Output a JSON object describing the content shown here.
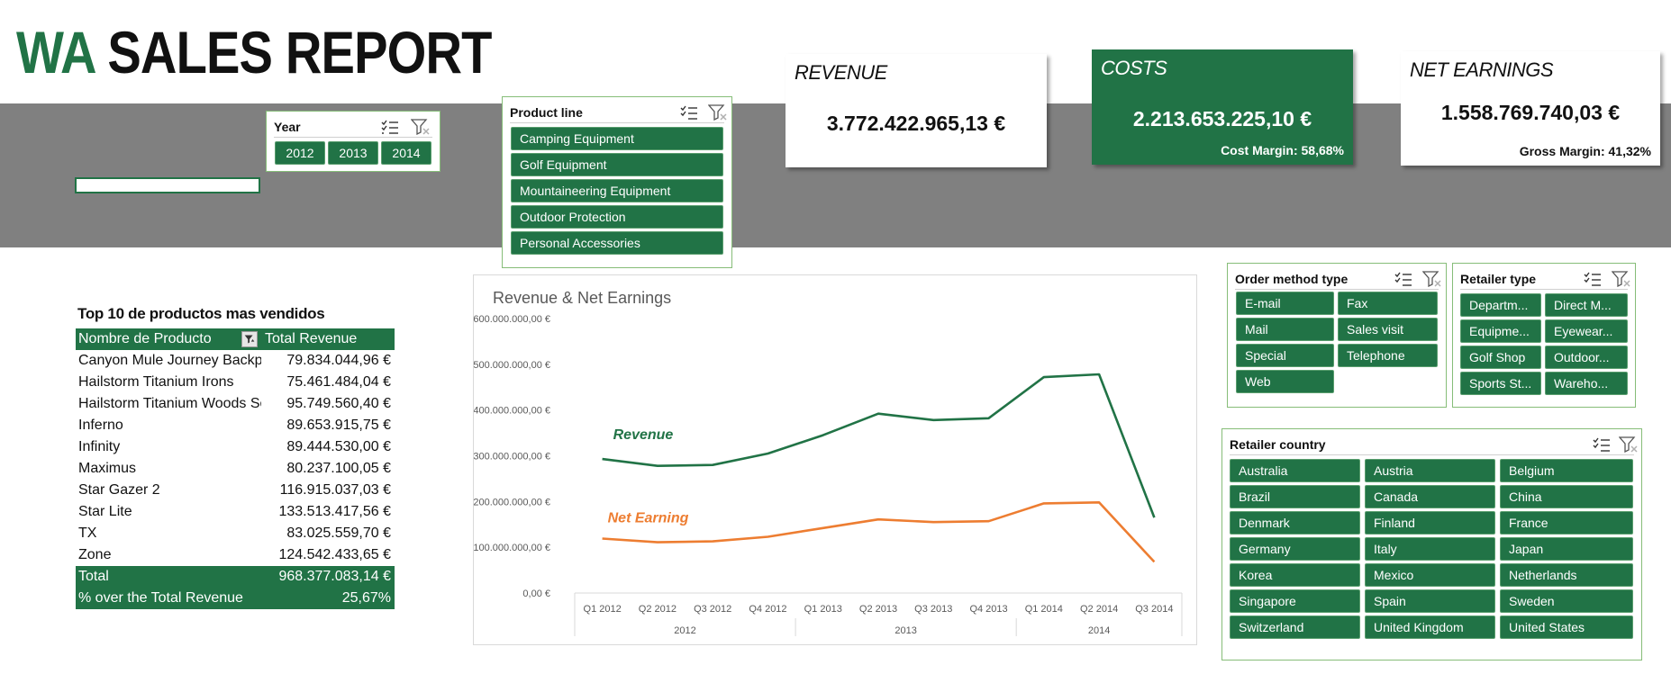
{
  "report_title": {
    "part1": "WA",
    "part2": "SALES REPORT"
  },
  "year_slicer": {
    "title": "Year",
    "items": [
      "2012",
      "2013",
      "2014"
    ]
  },
  "product_line_slicer": {
    "title": "Product line",
    "items": [
      "Camping Equipment",
      "Golf Equipment",
      "Mountaineering Equipment",
      "Outdoor Protection",
      "Personal Accessories"
    ]
  },
  "kpis": {
    "revenue": {
      "title": "REVENUE",
      "value": "3.772.422.965,13 €"
    },
    "costs": {
      "title": "COSTS",
      "value": "2.213.653.225,10 €",
      "note": "Cost Margin: 58,68%"
    },
    "net": {
      "title": "NET EARNINGS",
      "value": "1.558.769.740,03 €",
      "note": "Gross Margin: 41,32%"
    }
  },
  "top10": {
    "title": "Top 10 de productos mas vendidos",
    "col1": "Nombre de Producto",
    "col2": "Total Revenue",
    "rows": [
      {
        "name": "Canyon Mule Journey Backpack",
        "value": "79.834.044,96 €"
      },
      {
        "name": "Hailstorm Titanium Irons",
        "value": "75.461.484,04 €"
      },
      {
        "name": "Hailstorm Titanium Woods Set",
        "value": "95.749.560,40 €"
      },
      {
        "name": "Inferno",
        "value": "89.653.915,75 €"
      },
      {
        "name": "Infinity",
        "value": "89.444.530,00 €"
      },
      {
        "name": "Maximus",
        "value": "80.237.100,05 €"
      },
      {
        "name": "Star Gazer 2",
        "value": "116.915.037,03 €"
      },
      {
        "name": "Star Lite",
        "value": "133.513.417,56 €"
      },
      {
        "name": "TX",
        "value": "83.025.559,70 €"
      },
      {
        "name": "Zone",
        "value": "124.542.433,65 €"
      }
    ],
    "total_label": "Total",
    "total_value": "968.377.083,14 €",
    "pct_label": "% over the Total Revenue",
    "pct_value": "25,67%"
  },
  "order_method_slicer": {
    "title": "Order method type",
    "items": [
      "E-mail",
      "Fax",
      "Mail",
      "Sales visit",
      "Special",
      "Telephone",
      "Web"
    ]
  },
  "retailer_type_slicer": {
    "title": "Retailer type",
    "items": [
      "Departm...",
      "Direct M...",
      "Equipme...",
      "Eyewear...",
      "Golf Shop",
      "Outdoor...",
      "Sports St...",
      "Wareho..."
    ]
  },
  "retailer_country_slicer": {
    "title": "Retailer country",
    "items": [
      "Australia",
      "Austria",
      "Belgium",
      "Brazil",
      "Canada",
      "China",
      "Denmark",
      "Finland",
      "France",
      "Germany",
      "Italy",
      "Japan",
      "Korea",
      "Mexico",
      "Netherlands",
      "Singapore",
      "Spain",
      "Sweden",
      "Switzerland",
      "United Kingdom",
      "United States"
    ]
  },
  "colors": {
    "accent": "#217346",
    "band": "#808080",
    "revenue_line": "#217346",
    "net_line": "#ED7D31"
  },
  "chart_data": {
    "type": "line",
    "title": "Revenue & Net Earnings",
    "categories": [
      "Q1 2012",
      "Q2 2012",
      "Q3 2012",
      "Q4 2012",
      "Q1 2013",
      "Q2 2013",
      "Q3 2013",
      "Q4 2013",
      "Q1 2014",
      "Q2 2014",
      "Q3 2014"
    ],
    "category_labels": [
      "Q1 2012",
      "Q2 2012",
      "Q3 2012",
      "Q4 2012",
      "Q1 2013",
      "Q2 2013",
      "Q3 2013",
      "Q4 2013",
      "Q1 2014",
      "Q2 2014",
      "Q3 2014"
    ],
    "year_groups": [
      {
        "label": "2012",
        "count": 4
      },
      {
        "label": "2013",
        "count": 4
      },
      {
        "label": "2014",
        "count": 3
      }
    ],
    "ylim": [
      0,
      600000000
    ],
    "yticks": [
      0,
      100000000,
      200000000,
      300000000,
      400000000,
      500000000,
      600000000
    ],
    "ytick_labels": [
      "0,00 €",
      "100.000.000,00 €",
      "200.000.000,00 €",
      "300.000.000,00 €",
      "400.000.000,00 €",
      "500.000.000,00 €",
      "600.000.000,00 €"
    ],
    "grid": false,
    "series": [
      {
        "name": "Revenue",
        "color": "#217346",
        "values": [
          293000000,
          278000000,
          280000000,
          305000000,
          345000000,
          392000000,
          378000000,
          382000000,
          472000000,
          478000000,
          165000000
        ]
      },
      {
        "name": "Net Earning",
        "color": "#ED7D31",
        "values": [
          119000000,
          111000000,
          113000000,
          123000000,
          142000000,
          161000000,
          155000000,
          157000000,
          196000000,
          198000000,
          68000000
        ]
      }
    ]
  }
}
